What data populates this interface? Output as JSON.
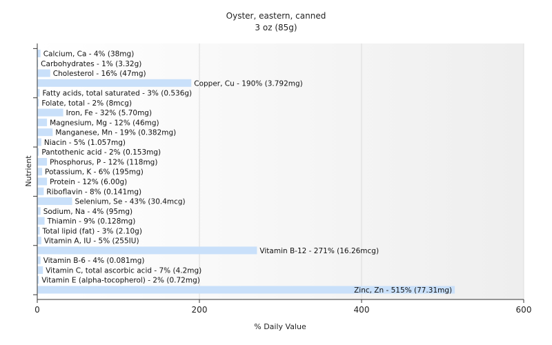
{
  "chart_data": {
    "type": "bar",
    "orientation": "horizontal",
    "title": "Oyster, eastern, canned",
    "subtitle": "3 oz (85g)",
    "xlabel": "% Daily Value",
    "ylabel": "Nutrient",
    "xlim": [
      0,
      600
    ],
    "xticks": [
      "0",
      "200",
      "400",
      "600"
    ],
    "grid": true,
    "bar_color": "#c9e0fa",
    "categories": [
      "Calcium, Ca",
      "Carbohydrates",
      "Cholesterol",
      "Copper, Cu",
      "Fatty acids, total saturated",
      "Folate, total",
      "Iron, Fe",
      "Magnesium, Mg",
      "Manganese, Mn",
      "Niacin",
      "Pantothenic acid",
      "Phosphorus, P",
      "Potassium, K",
      "Protein",
      "Riboflavin",
      "Selenium, Se",
      "Sodium, Na",
      "Thiamin",
      "Total lipid (fat)",
      "Vitamin A, IU",
      "Vitamin B-12",
      "Vitamin B-6",
      "Vitamin C, total ascorbic acid",
      "Vitamin E (alpha-tocopherol)",
      "Zinc, Zn"
    ],
    "values": [
      4,
      1,
      16,
      190,
      3,
      2,
      32,
      12,
      19,
      5,
      2,
      12,
      6,
      12,
      8,
      43,
      4,
      9,
      3,
      5,
      271,
      4,
      7,
      2,
      515
    ],
    "labels": [
      "Calcium, Ca - 4% (38mg)",
      "Carbohydrates - 1% (3.32g)",
      "Cholesterol - 16% (47mg)",
      "Copper, Cu - 190% (3.792mg)",
      "Fatty acids, total saturated - 3% (0.536g)",
      "Folate, total - 2% (8mcg)",
      "Iron, Fe - 32% (5.70mg)",
      "Magnesium, Mg - 12% (46mg)",
      "Manganese, Mn - 19% (0.382mg)",
      "Niacin - 5% (1.057mg)",
      "Pantothenic acid - 2% (0.153mg)",
      "Phosphorus, P - 12% (118mg)",
      "Potassium, K - 6% (195mg)",
      "Protein - 12% (6.00g)",
      "Riboflavin - 8% (0.141mg)",
      "Selenium, Se - 43% (30.4mcg)",
      "Sodium, Na - 4% (95mg)",
      "Thiamin - 9% (0.128mg)",
      "Total lipid (fat) - 3% (2.10g)",
      "Vitamin A, IU - 5% (255IU)",
      "Vitamin B-12 - 271% (16.26mcg)",
      "Vitamin B-6 - 4% (0.081mg)",
      "Vitamin C, total ascorbic acid - 7% (4.2mg)",
      "Vitamin E (alpha-tocopherol) - 2% (0.72mg)",
      "Zinc, Zn - 515% (77.31mg)"
    ]
  }
}
